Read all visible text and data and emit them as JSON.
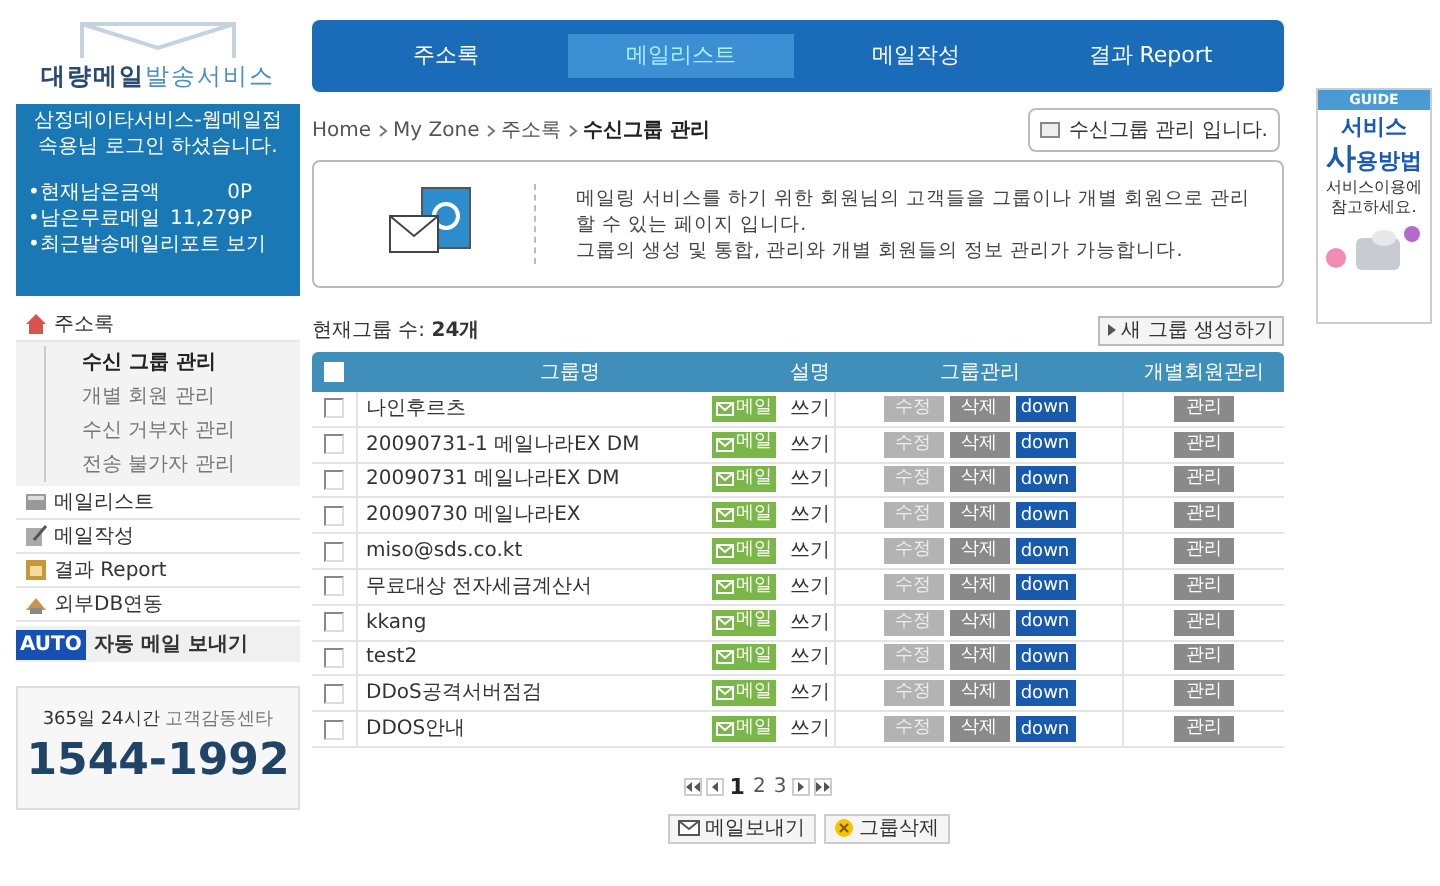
{
  "logo": {
    "strong": "대량메일",
    "light": "발송서비스"
  },
  "account": {
    "greeting": "삼정데이타서비스-웹메일접속용님 로그인 하셨습니다.",
    "stats": [
      {
        "label": "•현재남은금액",
        "value": "0P"
      },
      {
        "label": "•남은무료메일",
        "value": "11,279P"
      },
      {
        "label": "•최근발송메일리포트 보기"
      }
    ]
  },
  "sidebar": {
    "items": [
      {
        "label": "주소록",
        "kind": "home",
        "children": [
          {
            "label": "수신 그룹 관리",
            "selected": true
          },
          {
            "label": "개별 회원 관리",
            "selected": false
          },
          {
            "label": "수신 거부자 관리",
            "selected": false
          },
          {
            "label": "전송 불가자 관리",
            "selected": false
          }
        ]
      },
      {
        "label": "메일리스트",
        "kind": "list"
      },
      {
        "label": "메일작성",
        "kind": "write"
      },
      {
        "label": "결과 Report",
        "kind": "report"
      },
      {
        "label": "외부DB연동",
        "kind": "db"
      }
    ],
    "auto": {
      "badge": "AUTO",
      "label": "자동 메일 보내기"
    }
  },
  "support": {
    "caption_dark": "365일 24시간",
    "caption_light": "고객감동센타",
    "phone": "1544-1992"
  },
  "tabs": [
    {
      "label": "주소록",
      "selected": false
    },
    {
      "label": "메일리스트",
      "selected": true
    },
    {
      "label": "메일작성",
      "selected": false
    },
    {
      "label": "결과 Report",
      "selected": false
    }
  ],
  "breadcrumb": [
    "Home",
    "My Zone",
    "주소록",
    "수신그룹 관리"
  ],
  "page_tip": "수신그룹 관리 입니다.",
  "intro": "메일링 서비스를 하기 위한 회원님의 고객들을 그룹이나 개별 회원으로 관리할 수 있는 페이지 입니다.\n그룹의 생성 및 통합, 관리와 개별 회원들의 정보 관리가 가능합니다.",
  "group_count": {
    "label": "현재그룹 수:",
    "value": "24개"
  },
  "new_group_button": "새 그룹 생성하기",
  "table": {
    "header_checked": false,
    "columns": [
      "그룹명",
      "설명",
      "그룹관리",
      "개별회원관리"
    ],
    "rows": [
      {
        "checked": false,
        "name": "나인후르츠",
        "mail": "메일",
        "desc": "쓰기",
        "edit": "수정",
        "delete": "삭제",
        "down": "down",
        "manage": "관리"
      },
      {
        "checked": false,
        "name": "20090731-1 메일나라EX DM",
        "mail": "메일",
        "desc": "쓰기",
        "edit": "수정",
        "delete": "삭제",
        "down": "down",
        "manage": "관리"
      },
      {
        "checked": false,
        "name": "20090731 메일나라EX DM",
        "mail": "메일",
        "desc": "쓰기",
        "edit": "수정",
        "delete": "삭제",
        "down": "down",
        "manage": "관리"
      },
      {
        "checked": false,
        "name": "20090730 메일나라EX",
        "mail": "메일",
        "desc": "쓰기",
        "edit": "수정",
        "delete": "삭제",
        "down": "down",
        "manage": "관리"
      },
      {
        "checked": false,
        "name": "miso@sds.co.kt",
        "mail": "메일",
        "desc": "쓰기",
        "edit": "수정",
        "delete": "삭제",
        "down": "down",
        "manage": "관리"
      },
      {
        "checked": false,
        "name": "무료대상 전자세금계산서",
        "mail": "메일",
        "desc": "쓰기",
        "edit": "수정",
        "delete": "삭제",
        "down": "down",
        "manage": "관리"
      },
      {
        "checked": false,
        "name": "kkang",
        "mail": "메일",
        "desc": "쓰기",
        "edit": "수정",
        "delete": "삭제",
        "down": "down",
        "manage": "관리"
      },
      {
        "checked": false,
        "name": "test2",
        "mail": "메일",
        "desc": "쓰기",
        "edit": "수정",
        "delete": "삭제",
        "down": "down",
        "manage": "관리"
      },
      {
        "checked": false,
        "name": "DDoS공격서버점검",
        "mail": "메일",
        "desc": "쓰기",
        "edit": "수정",
        "delete": "삭제",
        "down": "down",
        "manage": "관리"
      },
      {
        "checked": false,
        "name": "DDOS안내",
        "mail": "메일",
        "desc": "쓰기",
        "edit": "수정",
        "delete": "삭제",
        "down": "down",
        "manage": "관리"
      }
    ]
  },
  "pagination": [
    {
      "label": "1",
      "selected": true
    },
    {
      "label": "2",
      "selected": false
    },
    {
      "label": "3",
      "selected": false
    }
  ],
  "actions": [
    {
      "label": "메일보내기",
      "kind": "mail"
    },
    {
      "label": "그룹삭제",
      "kind": "delete"
    }
  ],
  "guide": {
    "badge": "GUIDE",
    "line1": "서비스",
    "line2_big": "사",
    "line2_rest": "용방법",
    "note": "서비스이용에 참고하세요."
  }
}
